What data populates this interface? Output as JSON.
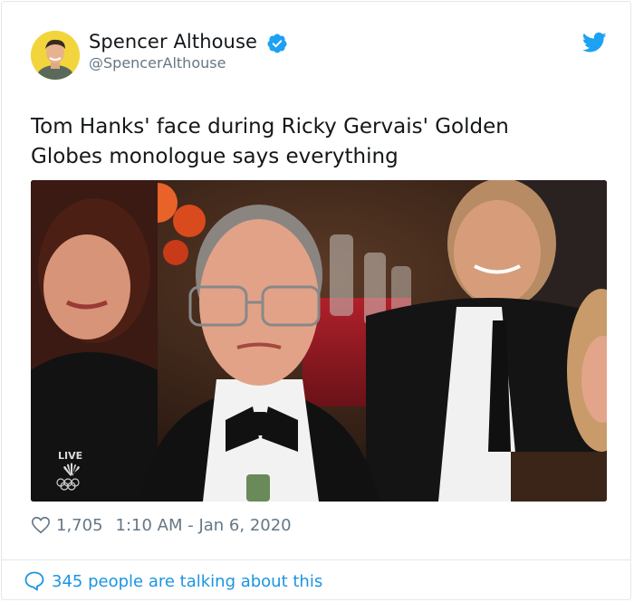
{
  "tweet": {
    "author": {
      "name": "Spencer Althouse",
      "handle": "@SpencerAlthouse",
      "verified": true,
      "avatar_icon": "profile-photo"
    },
    "text": "Tom Hanks' face during Ricky Gervais' Golden Globes monologue says everything",
    "media": {
      "type": "photo",
      "overlay_text": "LIVE",
      "overlay_logo": "nbc-peacock-icon"
    },
    "likes": "1,705",
    "timestamp": "1:10 AM - Jan 6, 2020",
    "conversation": "345 people are talking about this"
  },
  "colors": {
    "link": "#1b95e0",
    "muted": "#657786",
    "text": "#14171a",
    "verified": "#1da1f2"
  },
  "icons": [
    "verified-badge-icon",
    "twitter-bird-icon",
    "heart-icon",
    "speech-bubble-icon"
  ]
}
